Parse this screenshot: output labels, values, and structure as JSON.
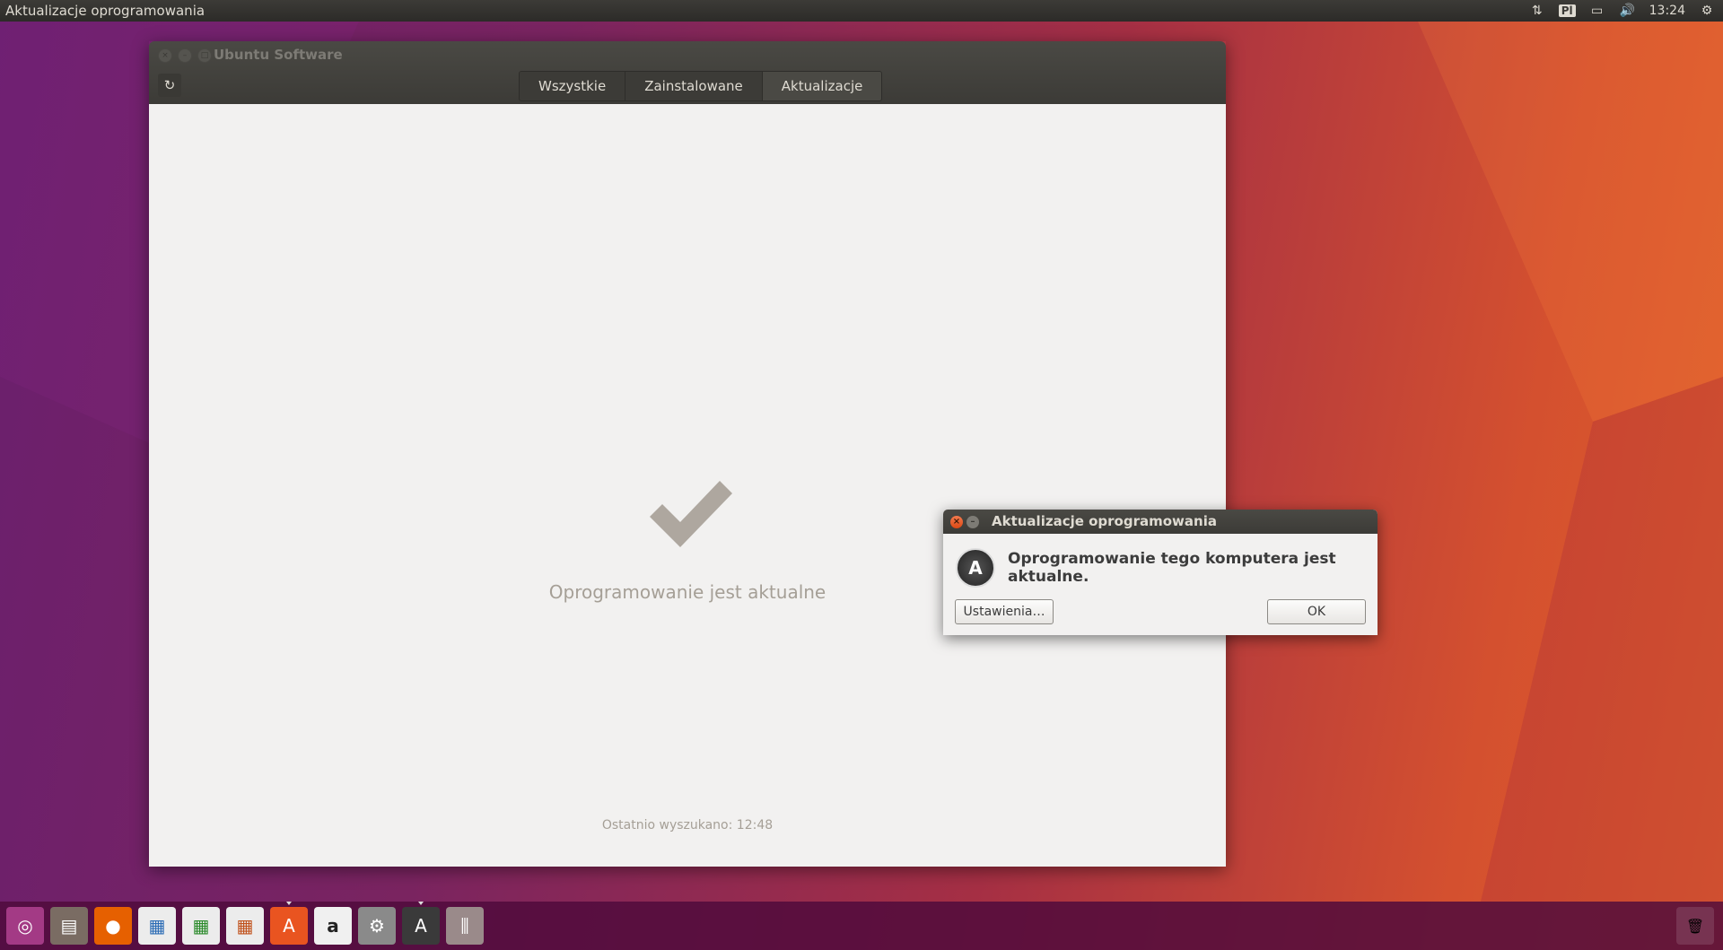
{
  "top_panel": {
    "title": "Aktualizacje oprogramowania",
    "keyboard_layout": "Pl",
    "clock": "13:24"
  },
  "window": {
    "title": "Ubuntu Software",
    "tabs": [
      {
        "label": "Wszystkie"
      },
      {
        "label": "Zainstalowane"
      },
      {
        "label": "Aktualizacje"
      }
    ],
    "active_tab": "Aktualizacje",
    "status_text": "Oprogramowanie jest aktualne",
    "last_search": "Ostatnio wyszukano: 12:48"
  },
  "dialog": {
    "title": "Aktualizacje oprogramowania",
    "message": "Oprogramowanie tego komputera jest aktualne.",
    "settings_label": "Ustawienia…",
    "ok_label": "OK"
  },
  "launcher": {
    "items": [
      {
        "icon": "ubuntu-dash-icon"
      },
      {
        "icon": "files-icon"
      },
      {
        "icon": "firefox-icon"
      },
      {
        "icon": "writer-icon"
      },
      {
        "icon": "calc-icon"
      },
      {
        "icon": "impress-icon"
      },
      {
        "icon": "software-center-icon"
      },
      {
        "icon": "amazon-icon"
      },
      {
        "icon": "system-settings-icon"
      },
      {
        "icon": "software-updater-icon"
      },
      {
        "icon": "equalizer-icon"
      }
    ]
  },
  "colors": {
    "accent": "#e95420",
    "panel": "#3c3b37",
    "content_bg": "#f2f1f0",
    "muted_text": "#a59f96"
  }
}
